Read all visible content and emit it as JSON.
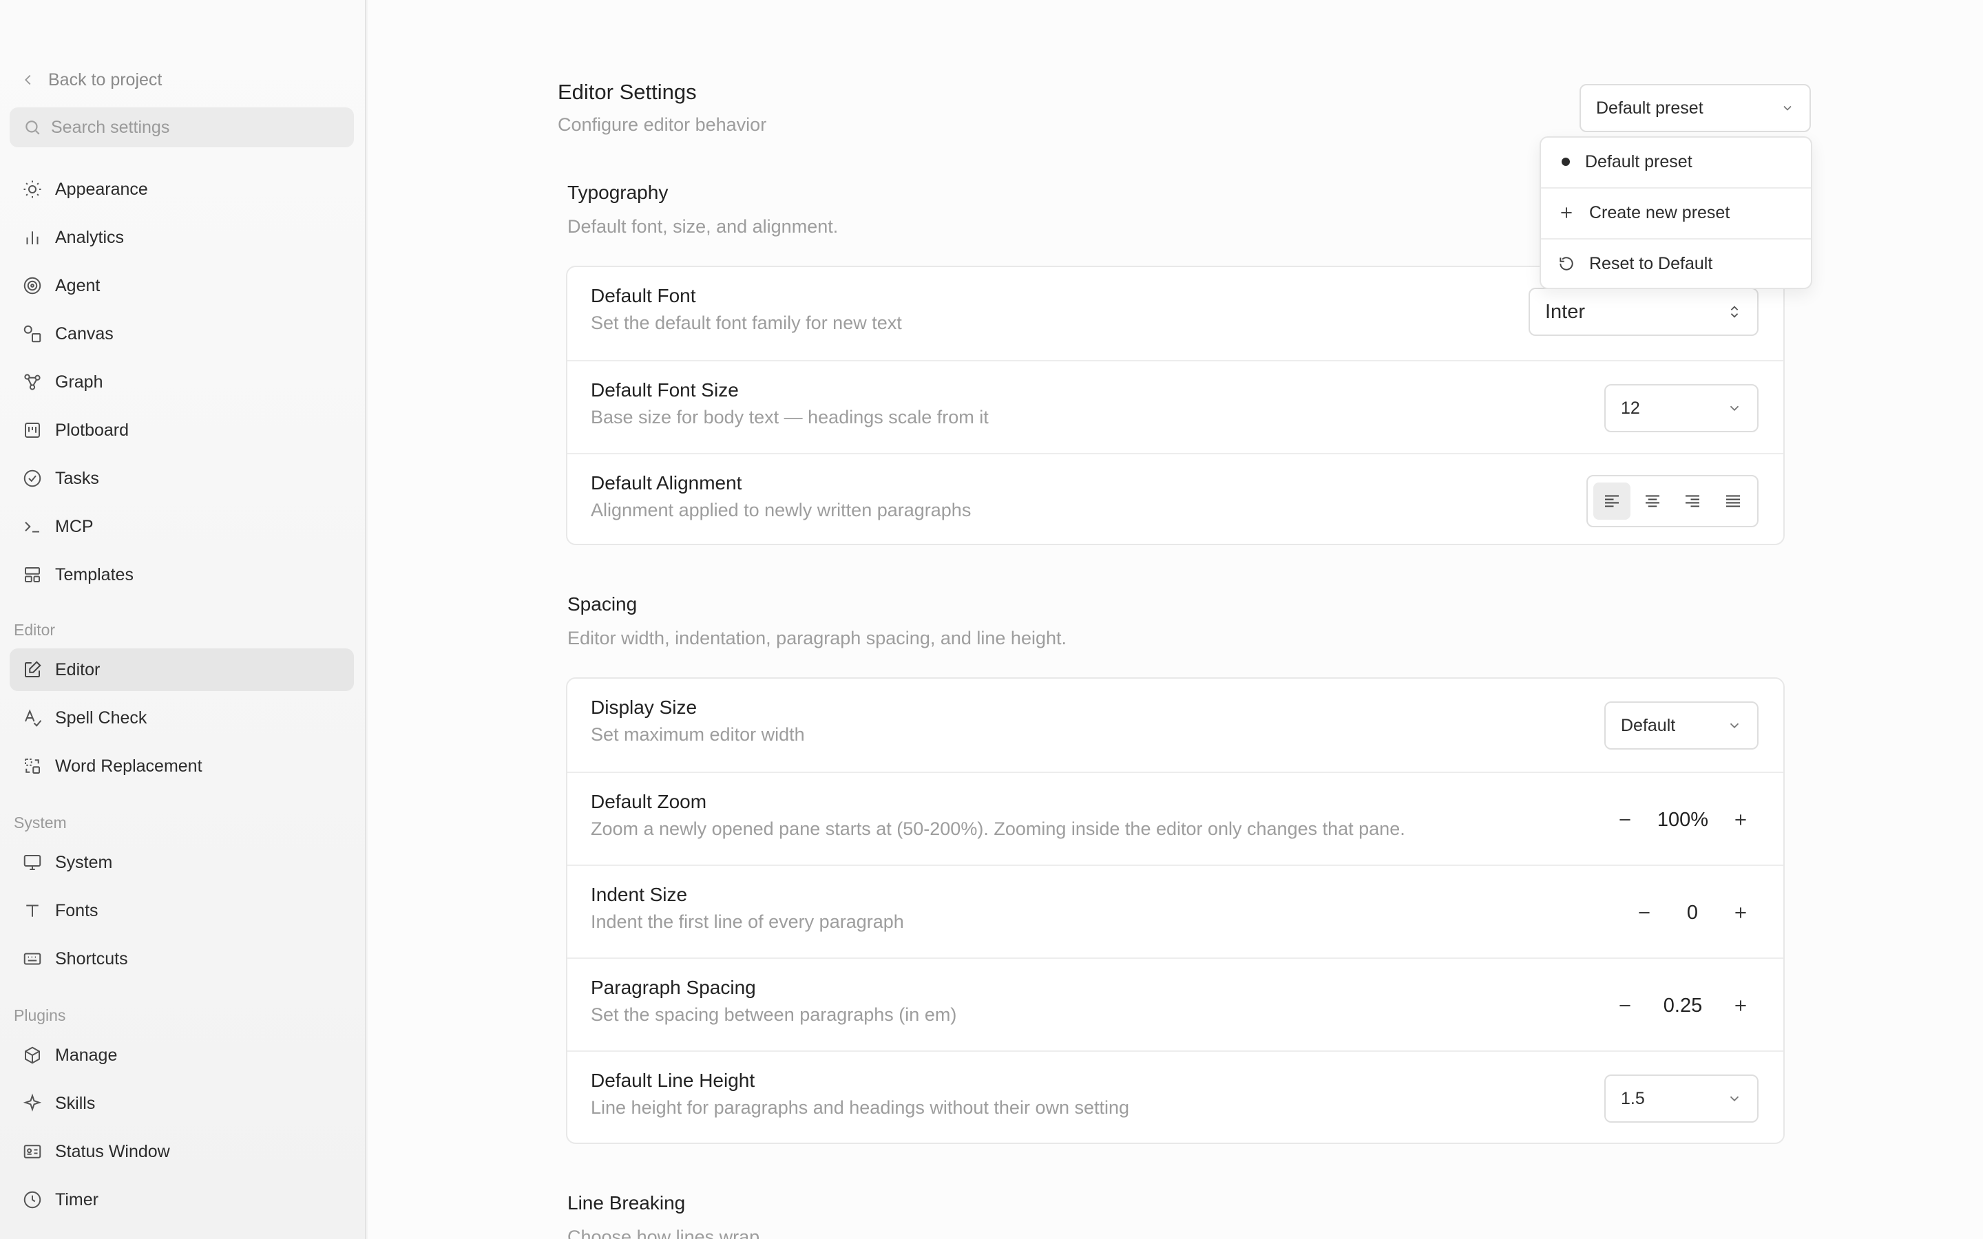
{
  "sidebar": {
    "back_label": "Back to project",
    "search_placeholder": "Search settings",
    "items_top": [
      {
        "label": "Appearance",
        "icon": "sun-icon"
      },
      {
        "label": "Analytics",
        "icon": "bar-chart-icon"
      },
      {
        "label": "Agent",
        "icon": "spiral-icon"
      },
      {
        "label": "Canvas",
        "icon": "shapes-icon"
      },
      {
        "label": "Graph",
        "icon": "graph-icon"
      },
      {
        "label": "Plotboard",
        "icon": "board-icon"
      },
      {
        "label": "Tasks",
        "icon": "check-circle-icon"
      },
      {
        "label": "MCP",
        "icon": "terminal-icon"
      },
      {
        "label": "Templates",
        "icon": "layout-icon"
      }
    ],
    "section_editor": "Editor",
    "items_editor": [
      {
        "label": "Editor",
        "icon": "edit-icon",
        "active": true
      },
      {
        "label": "Spell Check",
        "icon": "spell-check-icon"
      },
      {
        "label": "Word Replacement",
        "icon": "replace-icon"
      }
    ],
    "section_system": "System",
    "items_system": [
      {
        "label": "System",
        "icon": "monitor-icon"
      },
      {
        "label": "Fonts",
        "icon": "type-icon"
      },
      {
        "label": "Shortcuts",
        "icon": "keyboard-icon"
      }
    ],
    "section_plugins": "Plugins",
    "items_plugins": [
      {
        "label": "Manage",
        "icon": "package-icon"
      },
      {
        "label": "Skills",
        "icon": "sparkle-icon"
      },
      {
        "label": "Status Window",
        "icon": "id-card-icon"
      },
      {
        "label": "Timer",
        "icon": "clock-icon"
      }
    ]
  },
  "header": {
    "title": "Editor Settings",
    "subtitle": "Configure editor behavior",
    "preset_value": "Default preset"
  },
  "preset_menu": {
    "items": [
      "Default preset",
      "Create new preset",
      "Reset to Default"
    ]
  },
  "typography": {
    "title": "Typography",
    "subtitle": "Default font, size, and alignment.",
    "font": {
      "title": "Default Font",
      "desc": "Set the default font family for new text",
      "value": "Inter"
    },
    "font_size": {
      "title": "Default Font Size",
      "desc": "Base size for body text — headings scale from it",
      "value": "12"
    },
    "alignment": {
      "title": "Default Alignment",
      "desc": "Alignment applied to newly written paragraphs",
      "selected": "left"
    }
  },
  "spacing": {
    "title": "Spacing",
    "subtitle": "Editor width, indentation, paragraph spacing, and line height.",
    "display_size": {
      "title": "Display Size",
      "desc": "Set maximum editor width",
      "value": "Default"
    },
    "zoom": {
      "title": "Default Zoom",
      "desc": "Zoom a newly opened pane starts at (50-200%). Zooming inside the editor only changes that pane.",
      "value": "100%"
    },
    "indent": {
      "title": "Indent Size",
      "desc": "Indent the first line of every paragraph",
      "value": "0"
    },
    "paragraph": {
      "title": "Paragraph Spacing",
      "desc": "Set the spacing between paragraphs (in em)",
      "value": "0.25"
    },
    "line_height": {
      "title": "Default Line Height",
      "desc": "Line height for paragraphs and headings without their own setting",
      "value": "1.5"
    }
  },
  "line_breaking": {
    "title": "Line Breaking",
    "subtitle": "Choose how lines wrap."
  }
}
